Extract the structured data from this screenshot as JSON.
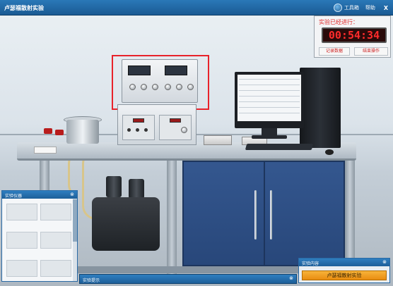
{
  "window": {
    "title": "卢瑟福散射实验",
    "toolbox_label": "工具箱",
    "help_label": "帮助",
    "close_label": "X"
  },
  "timer": {
    "label": "实验已经进行：",
    "time": "00:54:34",
    "record_button": "记录数据",
    "end_button": "结束操作"
  },
  "instrument_panel": {
    "title": "实验仪器",
    "toggle": "⊗"
  },
  "hint_bar": {
    "title": "实验提示",
    "toggle": "⊗"
  },
  "content_panel": {
    "title": "实验内容",
    "toggle": "⊗",
    "item": "卢瑟福散射实验"
  },
  "colors": {
    "accent": "#1d5f99",
    "highlight": "#e8222a",
    "timer_red": "#ff2b2b",
    "button_orange": "#f0a020"
  },
  "icons": {
    "toolbox": "circle-icon",
    "panel_toggle": "collapse-icon"
  }
}
